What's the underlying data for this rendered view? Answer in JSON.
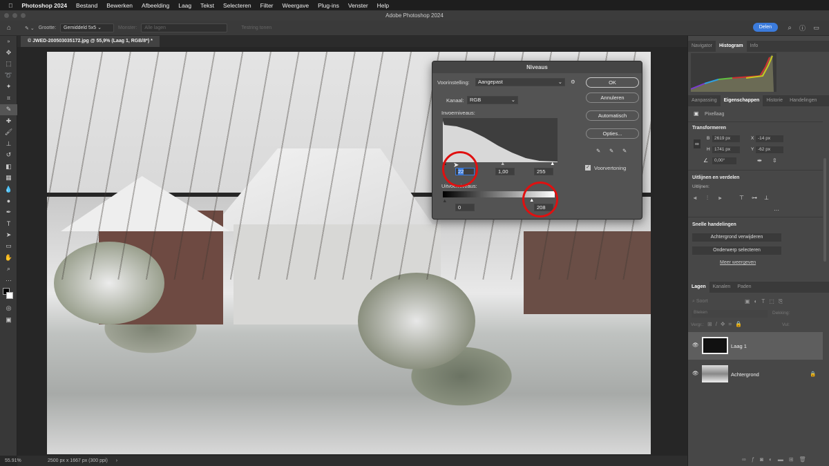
{
  "menubar": {
    "app": "Photoshop 2024",
    "items": [
      "Bestand",
      "Bewerken",
      "Afbeelding",
      "Laag",
      "Tekst",
      "Selecteren",
      "Filter",
      "Weergave",
      "Plug-ins",
      "Venster",
      "Help"
    ]
  },
  "window_title": "Adobe Photoshop 2024",
  "options": {
    "size_label": "Grootte:",
    "size_value": "Gemiddeld 5x5",
    "sample_label": "Monster:",
    "sample_value": "Alle lagen",
    "ring_label": "Testring tonen",
    "share": "Delen"
  },
  "document_tab": "© JWED-200503035172.jpg @ 55,9% (Laag 1, RGB/8*) *",
  "status": {
    "zoom": "55.91%",
    "info": "2500 px x 1667 px (300 ppi)"
  },
  "dialog": {
    "title": "Niveaus",
    "preset_label": "Voorinstelling:",
    "preset_value": "Aangepast",
    "channel_label": "Kanaal:",
    "channel_value": "RGB",
    "input_label": "Invoerniveaus:",
    "input_black": "22",
    "input_gamma": "1,00",
    "input_white": "255",
    "output_label": "Uitvoerniveaus:",
    "output_black": "0",
    "output_white": "208",
    "ok": "OK",
    "cancel": "Annuleren",
    "auto": "Automatisch",
    "options": "Opties...",
    "preview": "Voorvertoning",
    "preview_checked": true,
    "highlight_color": "#e01010"
  },
  "panels": {
    "top_tabs": [
      "Navigator",
      "Histogram",
      "Info"
    ],
    "prop_tabs": [
      "Aanpassing",
      "Eigenschappen",
      "Historie",
      "Handelingen"
    ],
    "layer_type": "Pixellaag",
    "transform": {
      "title": "Transformeren",
      "w_label": "B",
      "w": "2619 px",
      "h_label": "H",
      "h": "1741 px",
      "x_label": "X",
      "x": "-14 px",
      "y_label": "Y",
      "y": "-62 px",
      "angle": "0,00°"
    },
    "align": {
      "title": "Uitlijnen en verdelen",
      "label": "Uitlijnen:"
    },
    "quick": {
      "title": "Snelle handelingen",
      "remove_bg": "Achtergrond verwijderen",
      "select_subject": "Onderwerp selecteren",
      "more": "Meer weergeven"
    },
    "layer_tabs": [
      "Lagen",
      "Kanalen",
      "Paden"
    ],
    "layer_search": "Soort",
    "blend": "Bleken",
    "opacity_label": "Dekking:",
    "lock_label": "Vergr.:",
    "fill_label": "Vul:",
    "layers": [
      {
        "name": "Laag 1",
        "selected": true
      },
      {
        "name": "Achtergrond",
        "locked": true
      }
    ]
  },
  "colors": {
    "accent": "#3b7bdc"
  }
}
